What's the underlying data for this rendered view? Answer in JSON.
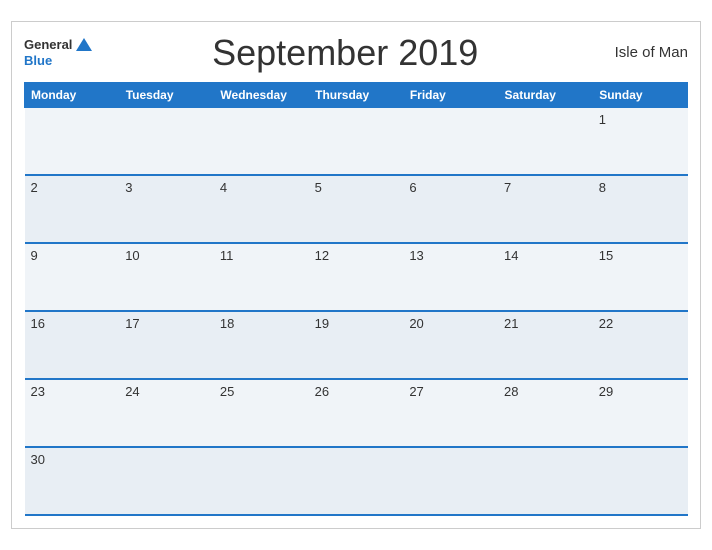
{
  "header": {
    "title": "September 2019",
    "region": "Isle of Man",
    "logo_general": "General",
    "logo_blue": "Blue"
  },
  "weekdays": [
    "Monday",
    "Tuesday",
    "Wednesday",
    "Thursday",
    "Friday",
    "Saturday",
    "Sunday"
  ],
  "weeks": [
    [
      null,
      null,
      null,
      null,
      null,
      null,
      "1"
    ],
    [
      "2",
      "3",
      "4",
      "5",
      "6",
      "7",
      "8"
    ],
    [
      "9",
      "10",
      "11",
      "12",
      "13",
      "14",
      "15"
    ],
    [
      "16",
      "17",
      "18",
      "19",
      "20",
      "21",
      "22"
    ],
    [
      "23",
      "24",
      "25",
      "26",
      "27",
      "28",
      "29"
    ],
    [
      "30",
      null,
      null,
      null,
      null,
      null,
      null
    ]
  ]
}
